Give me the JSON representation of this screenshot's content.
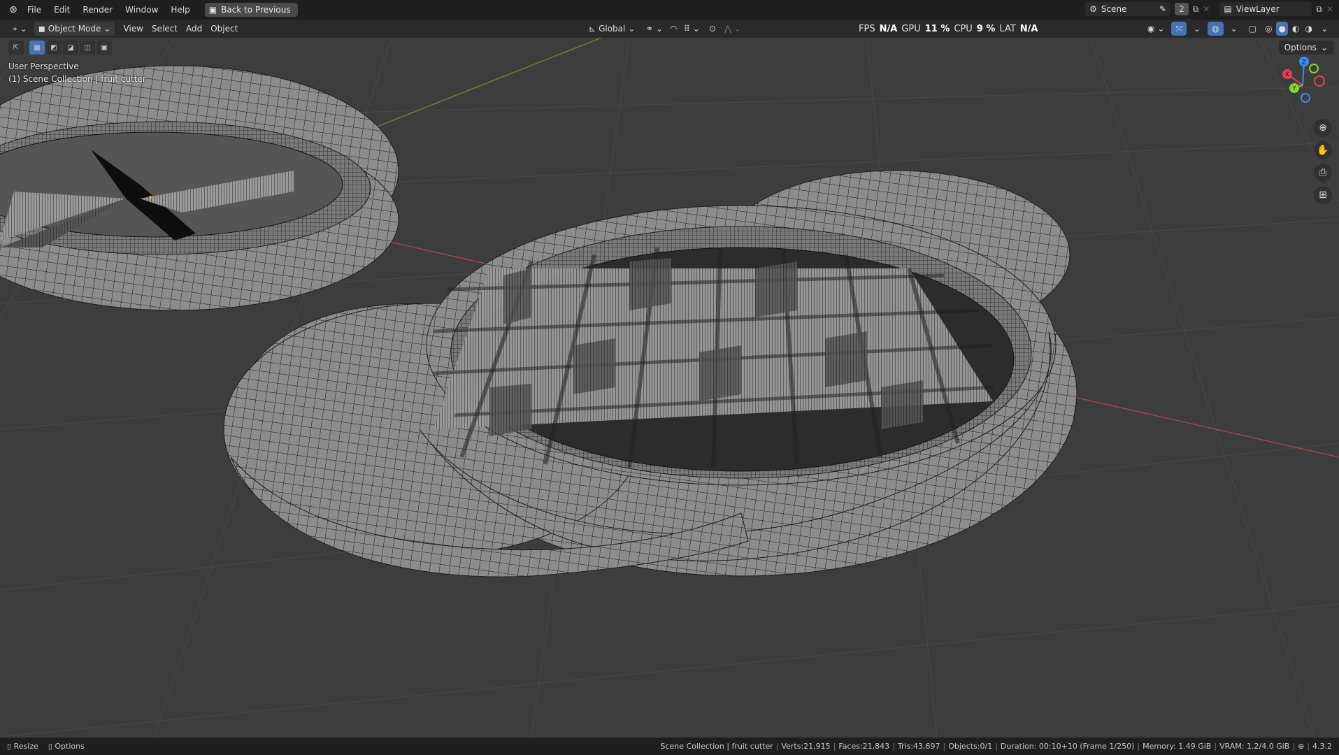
{
  "menu": {
    "items": [
      "File",
      "Edit",
      "Render",
      "Window",
      "Help"
    ],
    "back_button": "Back to Previous"
  },
  "top_right": {
    "scene_name": "Scene",
    "scene_users": "2",
    "view_layer": "ViewLayer"
  },
  "viewport_header": {
    "mode": "Object Mode",
    "menus": [
      "View",
      "Select",
      "Add",
      "Object"
    ],
    "transform_orientation": "Global"
  },
  "perf": {
    "fps_label": "FPS",
    "fps_value": "N/A",
    "gpu_label": "GPU",
    "gpu_value": "11 %",
    "cpu_label": "CPU",
    "cpu_value": "9 %",
    "lat_label": "LAT",
    "lat_value": "N/A"
  },
  "viewport": {
    "perspective_label": "User Perspective",
    "collection_label": "(1) Scene Collection | fruit cutter",
    "options_label": "Options"
  },
  "gizmo": {
    "x": "X",
    "y": "Y",
    "z": "Z",
    "x_color": "#e3425a",
    "y_color": "#8bd13a",
    "z_color": "#3b8ff0"
  },
  "status": {
    "left": [
      "Resize",
      "Options"
    ],
    "collection": "Scene Collection | fruit cutter",
    "verts": "Verts:21,915",
    "faces": "Faces:21,843",
    "tris": "Tris:43,697",
    "objects": "Objects:0/1",
    "duration": "Duration: 00:10+10 (Frame 1/250)",
    "memory": "Memory: 1.49 GiB",
    "vram": "VRAM: 1.2/4.0 GiB",
    "version": "4.3.2"
  },
  "colors": {
    "viewport_bg": "#3d3d3d",
    "mesh_surface": "#8e8e8e",
    "wire": "#1a1a1a",
    "active_tool": "#4772b3"
  }
}
